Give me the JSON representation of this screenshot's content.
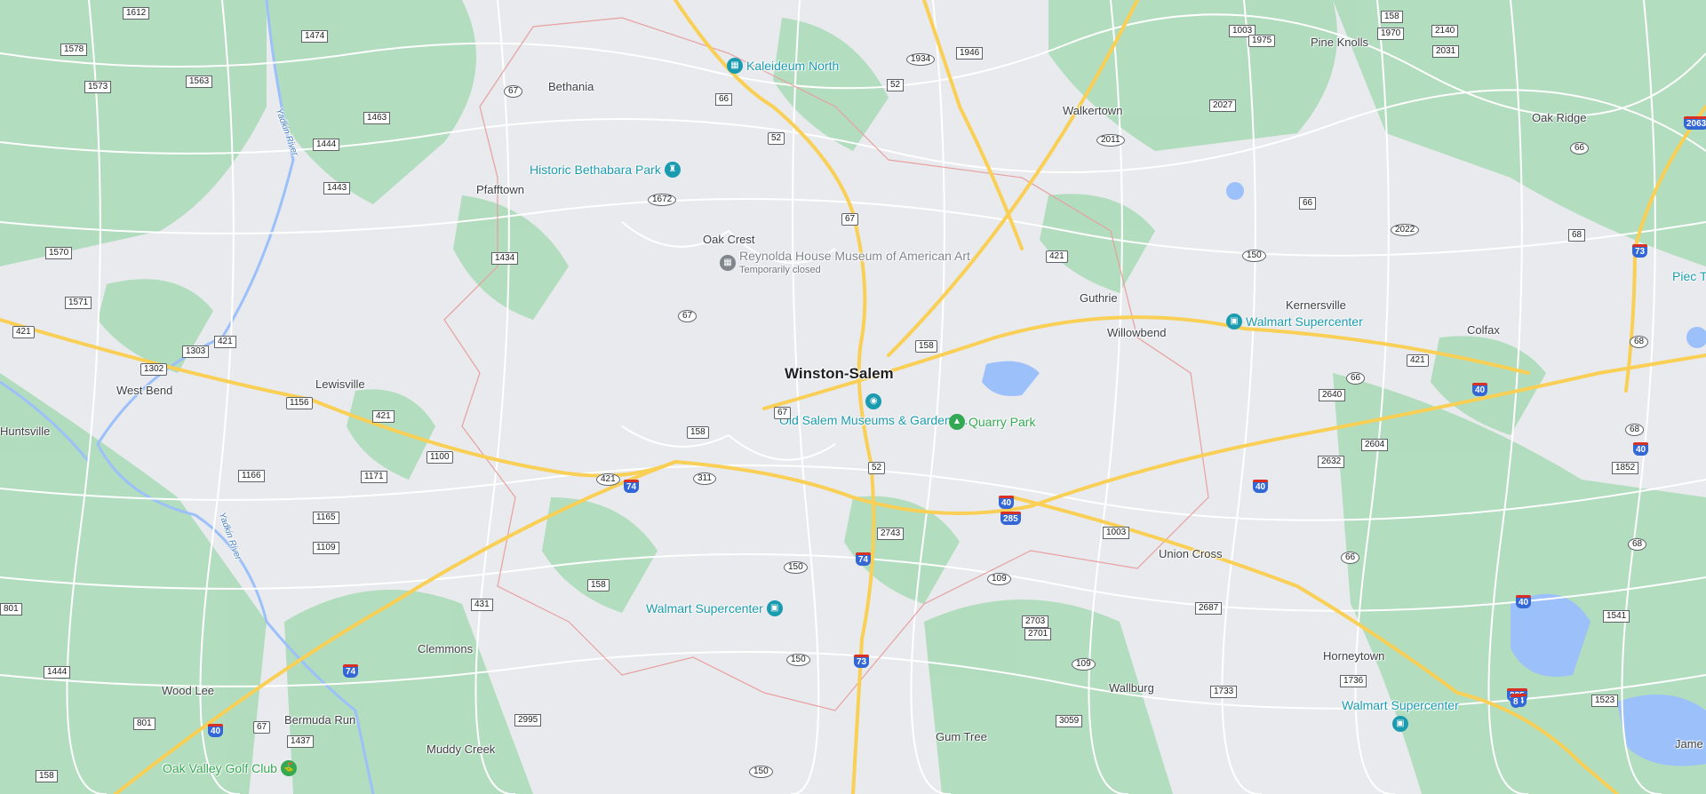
{
  "map": {
    "colors": {
      "land": "#e8eaed",
      "park": "#a8dab5",
      "water": "#9cc0f9",
      "major_road": "#f9cf55",
      "minor_road": "#ffffff",
      "boundary": "#e8a0a0",
      "poi_blue": "#1a9bb0",
      "poi_green": "#34a853",
      "poi_gray": "#80868b"
    },
    "city": "Winston-Salem",
    "places": [
      "Bethania",
      "Pfafftown",
      "Oak Crest",
      "Lewisville",
      "West Bend",
      "Huntsville",
      "Clemmons",
      "Wood Lee",
      "Bermuda Run",
      "Muddy Creek",
      "Walkertown",
      "Pine Knolls",
      "Oak Ridge",
      "Kernersville",
      "Guthrie",
      "Willowbend",
      "Colfax",
      "Union Cross",
      "Horneytown",
      "Wallburg",
      "Gum Tree",
      "Jame"
    ],
    "waters": [
      "Yadkin River",
      "Yadkin River"
    ],
    "pois": [
      {
        "name": "Kaleideum North",
        "icon": "museum-icon",
        "sub": ""
      },
      {
        "name": "Historic Bethabara Park",
        "icon": "landmark-icon",
        "sub": ""
      },
      {
        "name": "Reynolda House Museum of American Art",
        "icon": "museum-icon",
        "sub": "Temporarily closed"
      },
      {
        "name": "Old Salem Museums & Gardens...",
        "icon": "camera-icon",
        "sub": ""
      },
      {
        "name": "Quarry Park",
        "icon": "tree-icon",
        "sub": ""
      },
      {
        "name": "Walmart Supercenter",
        "icon": "shopping-bag-icon",
        "sub": ""
      },
      {
        "name": "Walmart Supercenter",
        "icon": "shopping-bag-icon",
        "sub": ""
      },
      {
        "name": "Walmart Supercenter",
        "icon": "shopping-bag-icon",
        "sub": ""
      },
      {
        "name": "Oak Valley Golf Club",
        "icon": "golf-icon",
        "sub": ""
      },
      {
        "name": "Piec Ti Intern Ai",
        "icon": "",
        "sub": ""
      }
    ],
    "routes": [
      "1612",
      "1474",
      "1578",
      "1573",
      "1563",
      "1463",
      "1444",
      "1443",
      "1570",
      "1434",
      "1571",
      "421",
      "1302",
      "1303",
      "421",
      "1156",
      "421",
      "1100",
      "1171",
      "1166",
      "1165",
      "1109",
      "431",
      "801",
      "1444",
      "801",
      "1437",
      "158",
      "67",
      "67",
      "1672",
      "66",
      "1934",
      "1946",
      "52",
      "52",
      "67",
      "67",
      "311",
      "158",
      "421",
      "158",
      "67",
      "421",
      "52",
      "2743",
      "150",
      "158",
      "150",
      "150",
      "2995",
      "109",
      "2703",
      "2701",
      "109",
      "3059",
      "2687",
      "1003",
      "1733",
      "1003",
      "1975",
      "158",
      "1970",
      "2140",
      "2031",
      "2027",
      "2011",
      "66",
      "2022",
      "150",
      "66",
      "68",
      "2063",
      "73",
      "2640",
      "66",
      "421",
      "40",
      "2632",
      "2604",
      "1852",
      "68",
      "40",
      "68",
      "66",
      "68",
      "1736",
      "1541",
      "1523",
      "40",
      "40",
      "74",
      "74",
      "40",
      "285",
      "285",
      "40",
      "74",
      "74",
      "73",
      "8"
    ]
  }
}
